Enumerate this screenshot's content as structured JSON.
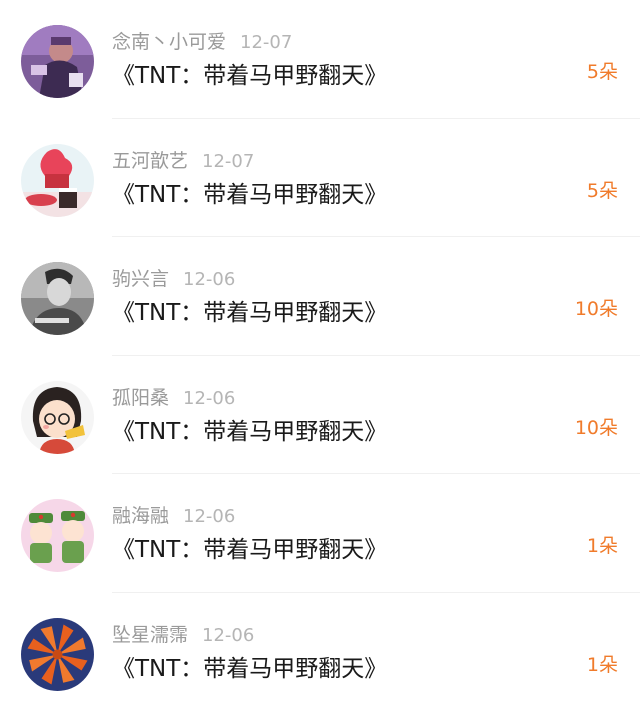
{
  "rows": [
    {
      "name": "念南丶小可爱",
      "date": "12-07",
      "gift": "《TNT：带着马甲野翻天》",
      "count": "5朵",
      "avatar": "avatar-purple-figure"
    },
    {
      "name": "五河歆艺",
      "date": "12-07",
      "gift": "《TNT：带着马甲野翻天》",
      "count": "5朵",
      "avatar": "avatar-icecream"
    },
    {
      "name": "驹兴言",
      "date": "12-06",
      "gift": "《TNT：带着马甲野翻天》",
      "count": "10朵",
      "avatar": "avatar-bw-portrait"
    },
    {
      "name": "孤阳桑",
      "date": "12-06",
      "gift": "《TNT：带着马甲野翻天》",
      "count": "10朵",
      "avatar": "avatar-cartoon-girl"
    },
    {
      "name": "融海融",
      "date": "12-06",
      "gift": "《TNT：带着马甲野翻天》",
      "count": "1朵",
      "avatar": "avatar-soldier-pair"
    },
    {
      "name": "坠星濡霈",
      "date": "12-06",
      "gift": "《TNT：带着马甲野翻天》",
      "count": "1朵",
      "avatar": "avatar-origami-star"
    }
  ],
  "colors": {
    "count": "#f07b2b",
    "name": "#9a9a9a",
    "title": "#1a1a1a"
  }
}
